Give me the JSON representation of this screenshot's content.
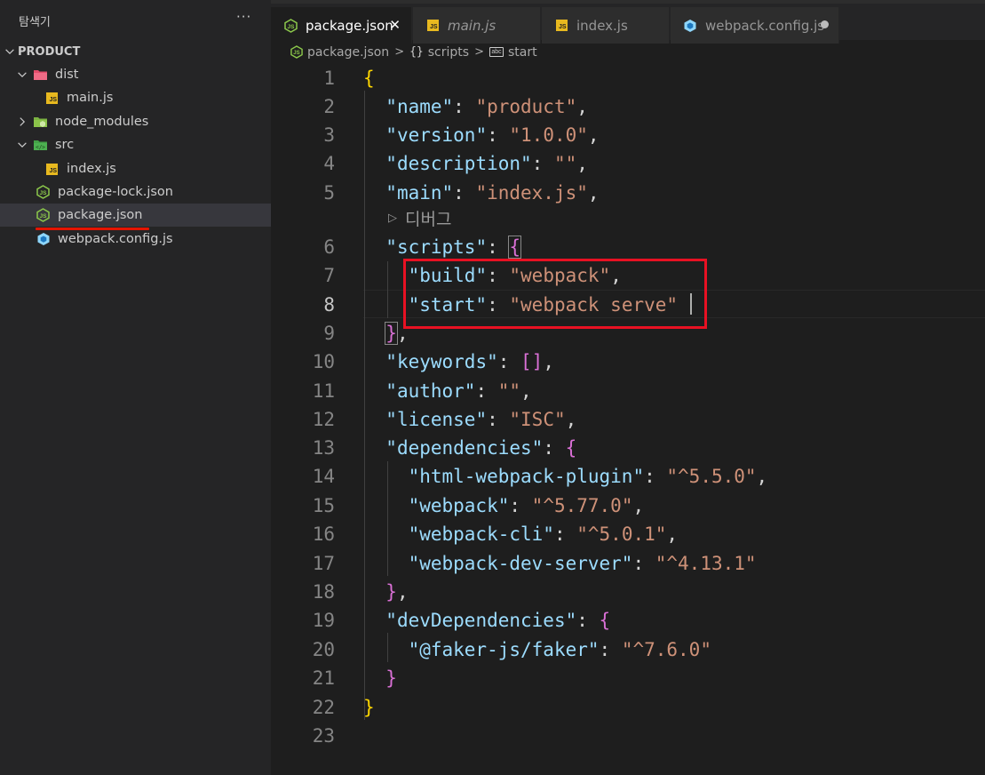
{
  "sidebar": {
    "title": "탐색기",
    "more_glyph": "···",
    "section_title": "PRODUCT",
    "items": [
      {
        "label": "dist"
      },
      {
        "label": "main.js"
      },
      {
        "label": "node_modules"
      },
      {
        "label": "src"
      },
      {
        "label": "index.js"
      },
      {
        "label": "package-lock.json"
      },
      {
        "label": "package.json"
      },
      {
        "label": "webpack.config.js"
      }
    ]
  },
  "tabs": [
    {
      "label": "package.json",
      "close_glyph": "✕"
    },
    {
      "label": "main.js"
    },
    {
      "label": "index.js"
    },
    {
      "label": "webpack.config.js"
    }
  ],
  "breadcrumb": {
    "file": "package.json",
    "sep": ">",
    "node1_glyph": "{}",
    "node1": "scripts",
    "node2_glyph": "abc",
    "node2": "start"
  },
  "editor": {
    "current_line": 8,
    "codelens": {
      "glyph": "▷",
      "label": "디버그"
    },
    "line_numbers": [
      "1",
      "2",
      "3",
      "4",
      "5",
      "6",
      "7",
      "8",
      "9",
      "10",
      "11",
      "12",
      "13",
      "14",
      "15",
      "16",
      "17",
      "18",
      "19",
      "20",
      "21",
      "22",
      "23"
    ],
    "tokens": {
      "l1_b": "{",
      "l2_k": "\"name\"",
      "l2_p": ": ",
      "l2_s": "\"product\"",
      "l2_c": ",",
      "l3_k": "\"version\"",
      "l3_p": ": ",
      "l3_s": "\"1.0.0\"",
      "l3_c": ",",
      "l4_k": "\"description\"",
      "l4_p": ": ",
      "l4_s": "\"\"",
      "l4_c": ",",
      "l5_k": "\"main\"",
      "l5_p": ": ",
      "l5_s": "\"index.js\"",
      "l5_c": ",",
      "l6_k": "\"scripts\"",
      "l6_p": ": ",
      "l6_b": "{",
      "l7_k": "\"build\"",
      "l7_p": ": ",
      "l7_s": "\"webpack\"",
      "l7_c": ",",
      "l8_k": "\"start\"",
      "l8_p": ": ",
      "l8_s": "\"webpack serve\"",
      "l9_b": "}",
      "l9_c": ",",
      "l10_k": "\"keywords\"",
      "l10_p": ": ",
      "l10_b": "[]",
      "l10_c": ",",
      "l11_k": "\"author\"",
      "l11_p": ": ",
      "l11_s": "\"\"",
      "l11_c": ",",
      "l12_k": "\"license\"",
      "l12_p": ": ",
      "l12_s": "\"ISC\"",
      "l12_c": ",",
      "l13_k": "\"dependencies\"",
      "l13_p": ": ",
      "l13_b": "{",
      "l14_k": "\"html-webpack-plugin\"",
      "l14_p": ": ",
      "l14_s": "\"^5.5.0\"",
      "l14_c": ",",
      "l15_k": "\"webpack\"",
      "l15_p": ": ",
      "l15_s": "\"^5.77.0\"",
      "l15_c": ",",
      "l16_k": "\"webpack-cli\"",
      "l16_p": ": ",
      "l16_s": "\"^5.0.1\"",
      "l16_c": ",",
      "l17_k": "\"webpack-dev-server\"",
      "l17_p": ": ",
      "l17_s": "\"^4.13.1\"",
      "l18_b": "}",
      "l18_c": ",",
      "l19_k": "\"devDependencies\"",
      "l19_p": ": ",
      "l19_b": "{",
      "l20_k": "\"@faker-js/faker\"",
      "l20_p": ": ",
      "l20_s": "\"^7.6.0\"",
      "l21_b": "}",
      "l22_b": "}"
    }
  },
  "colors": {
    "editor_bg": "#1e1e1e",
    "sidebar_bg": "#252526",
    "json_key": "#9cdcfe",
    "json_string": "#ce9178",
    "bracket_gold": "#ffd700",
    "bracket_purple": "#da70d6",
    "bracket_blue": "#179fff",
    "annotation_red": "#e81123",
    "js_badge": "#e8b91f",
    "node_green": "#8cc84b"
  }
}
